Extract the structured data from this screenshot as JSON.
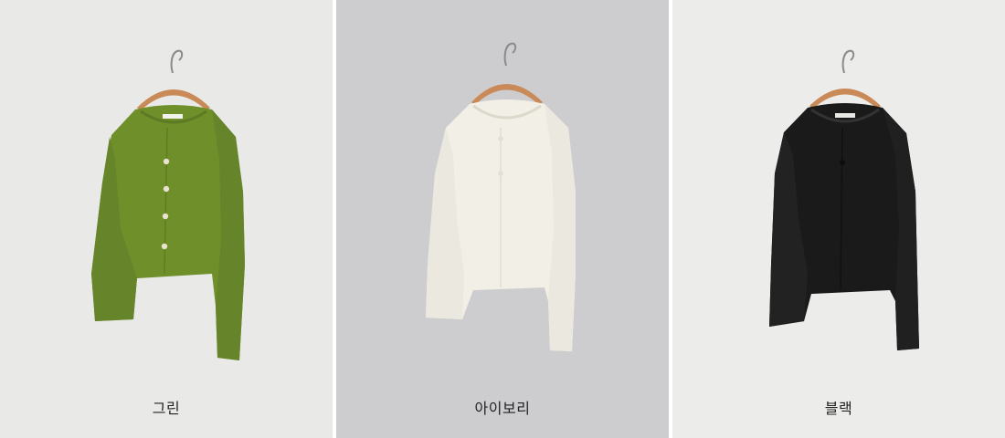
{
  "panels": [
    {
      "label": "그린",
      "background": "#e9e9e7",
      "garment_color": "#6f8f2a"
    },
    {
      "label": "아이보리",
      "background": "#cdcdcf",
      "garment_color": "#f2f0e6"
    },
    {
      "label": "블랙",
      "background": "#ececeb",
      "garment_color": "#1a1a1a"
    }
  ]
}
